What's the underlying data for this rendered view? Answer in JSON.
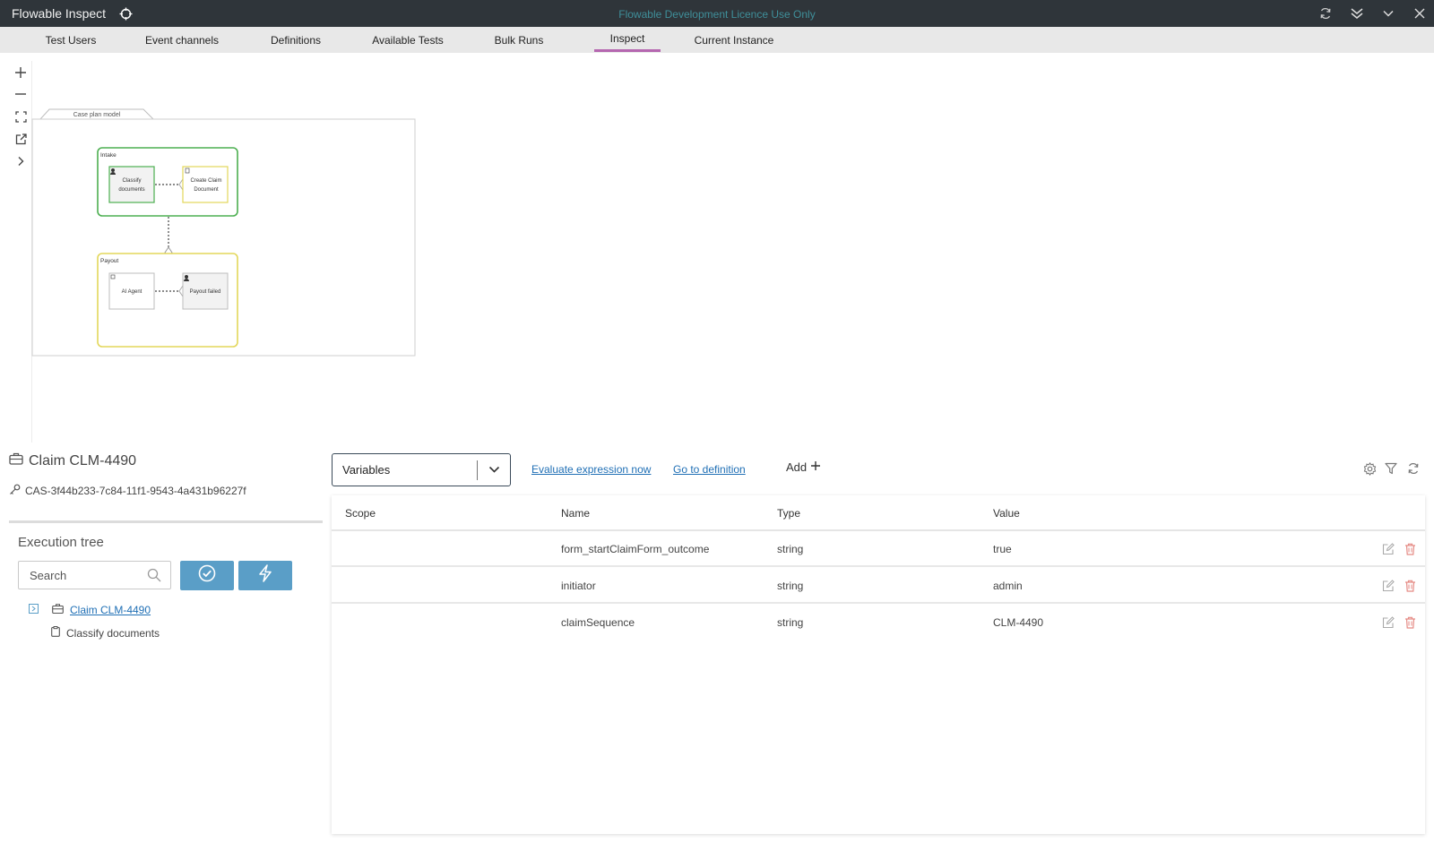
{
  "titlebar": {
    "app_title": "Flowable Inspect",
    "licence_text": "Flowable Development Licence Use Only"
  },
  "nav": {
    "tabs": [
      {
        "label": "Test Users"
      },
      {
        "label": "Event channels"
      },
      {
        "label": "Definitions"
      },
      {
        "label": "Available Tests"
      },
      {
        "label": "Bulk Runs"
      },
      {
        "label": "Inspect",
        "active": true
      },
      {
        "label": "Current Instance"
      }
    ]
  },
  "diagram": {
    "case_plan_label": "Case plan model",
    "stages": [
      {
        "label": "Intake",
        "color": "#4caf50"
      },
      {
        "label": "Payout",
        "color": "#e3d75a"
      }
    ],
    "tasks": {
      "classify": "Classify documents",
      "create_claim": "Create Claim Document",
      "ai_agent": "AI Agent",
      "payout_failed": "Payout failed"
    }
  },
  "instance": {
    "title": "Claim CLM-4490",
    "id": "CAS-3f44b233-7c84-11f1-9543-4a431b96227f"
  },
  "execution_tree": {
    "title": "Execution tree",
    "search_placeholder": "Search",
    "nodes": [
      {
        "label": "Claim CLM-4490"
      },
      {
        "label": "Classify documents"
      }
    ]
  },
  "variables_panel": {
    "select_value": "Variables",
    "evaluate_label": "Evaluate expression now",
    "goto_label": "Go to definition",
    "add_label": "Add",
    "columns": [
      "Scope",
      "Name",
      "Type",
      "Value"
    ],
    "rows": [
      {
        "scope": "",
        "name": "form_startClaimForm_outcome",
        "type": "string",
        "value": "true"
      },
      {
        "scope": "",
        "name": "initiator",
        "type": "string",
        "value": "admin"
      },
      {
        "scope": "",
        "name": "claimSequence",
        "type": "string",
        "value": "CLM-4490"
      }
    ]
  },
  "colors": {
    "titlebar_bg": "#2f353a",
    "active_tab_accent": "#b567b0",
    "primary_button": "#5a9ec7",
    "link": "#1f6fb5",
    "delete_icon": "#e58a84"
  }
}
